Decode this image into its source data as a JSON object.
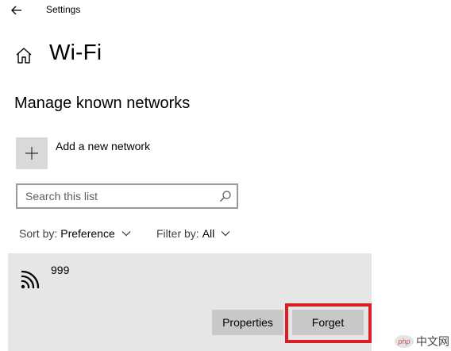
{
  "window": {
    "title": "Settings"
  },
  "header": {
    "title": "Wi-Fi"
  },
  "section": {
    "title": "Manage known networks"
  },
  "add_network": {
    "label": "Add a new network"
  },
  "search": {
    "placeholder": "Search this list",
    "value": ""
  },
  "sort": {
    "label": "Sort by:",
    "value": "Preference"
  },
  "filter": {
    "label": "Filter by:",
    "value": "All"
  },
  "networks": [
    {
      "name": "999",
      "icon": "wifi-icon",
      "actions": {
        "properties_label": "Properties",
        "forget_label": "Forget"
      }
    }
  ],
  "annotation": {
    "highlight_color": "#d81f26",
    "highlighted_target": "Forget"
  },
  "watermark": {
    "logo_text": "php",
    "text": "中文网"
  },
  "colors": {
    "card_bg": "#e6e6e6",
    "button_bg": "#c8c8c8",
    "add_tile_bg": "#d9d9d9"
  }
}
